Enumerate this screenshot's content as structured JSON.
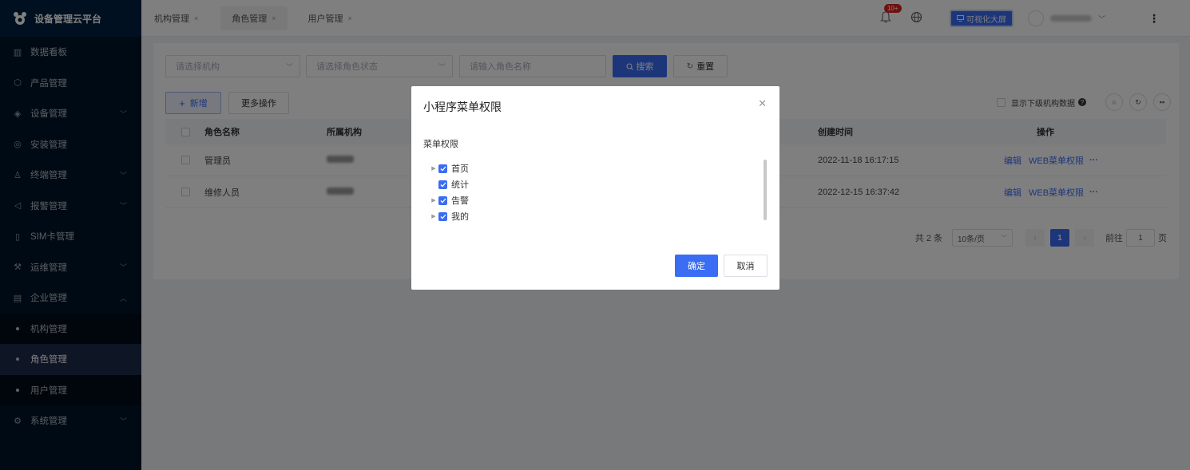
{
  "app": {
    "title": "设备管理云平台"
  },
  "sidebar": {
    "items": [
      {
        "label": "数据看板",
        "icon": "chart-icon"
      },
      {
        "label": "产品管理",
        "icon": "cube-icon"
      },
      {
        "label": "设备管理",
        "icon": "layers-icon",
        "chevron": "﹀"
      },
      {
        "label": "安装管理",
        "icon": "install-icon"
      },
      {
        "label": "终端管理",
        "icon": "person-icon",
        "chevron": "﹀"
      },
      {
        "label": "报警管理",
        "icon": "alarm-icon",
        "chevron": "﹀"
      },
      {
        "label": "SIM卡管理",
        "icon": "sim-icon"
      },
      {
        "label": "运维管理",
        "icon": "wrench-icon",
        "chevron": "﹀"
      },
      {
        "label": "企业管理",
        "icon": "building-icon",
        "chevron": "︿"
      }
    ],
    "sub_items": [
      {
        "label": "机构管理"
      },
      {
        "label": "角色管理"
      },
      {
        "label": "用户管理"
      }
    ],
    "last_item": {
      "label": "系统管理",
      "icon": "settings-icon",
      "chevron": "﹀"
    }
  },
  "header": {
    "tabs": [
      {
        "label": "机构管理",
        "close": "×"
      },
      {
        "label": "角色管理",
        "close": "×"
      },
      {
        "label": "用户管理",
        "close": "×"
      }
    ],
    "badge": "10+",
    "bigscreen_label": "可视化大屏",
    "user_chevron": "﹀",
    "kebab": "⋮"
  },
  "filters": {
    "org_placeholder": "请选择机构",
    "status_placeholder": "请选择角色状态",
    "name_placeholder": "请输入角色名称",
    "search_label": "搜索",
    "reset_label": "重置"
  },
  "toolbar": {
    "add_label": "新增",
    "more_label": "更多操作",
    "show_sub_label": "显示下级机构数据"
  },
  "table": {
    "columns": [
      "角色名称",
      "所属机构",
      "创建时间",
      "操作"
    ],
    "rows": [
      {
        "name": "管理员",
        "created": "2022-11-18 16:17:15"
      },
      {
        "name": "维修人员",
        "created": "2022-12-15 16:37:42"
      }
    ],
    "action_edit": "编辑",
    "action_web": "WEB菜单权限",
    "action_more": "···"
  },
  "pagination": {
    "total": "共 2 条",
    "page_size": "10条/页",
    "current_page": "1",
    "goto_label": "前往",
    "goto_value": "1",
    "page_unit": "页"
  },
  "modal": {
    "title": "小程序菜单权限",
    "section_label": "菜单权限",
    "tree": [
      {
        "label": "首页",
        "expandable": true
      },
      {
        "label": "统计",
        "expandable": false
      },
      {
        "label": "告警",
        "expandable": true
      },
      {
        "label": "我的",
        "expandable": true
      }
    ],
    "confirm_label": "确定",
    "cancel_label": "取消"
  },
  "colors": {
    "primary": "#3a6cf4",
    "sidebar": "#001529",
    "badge": "#e02020"
  }
}
